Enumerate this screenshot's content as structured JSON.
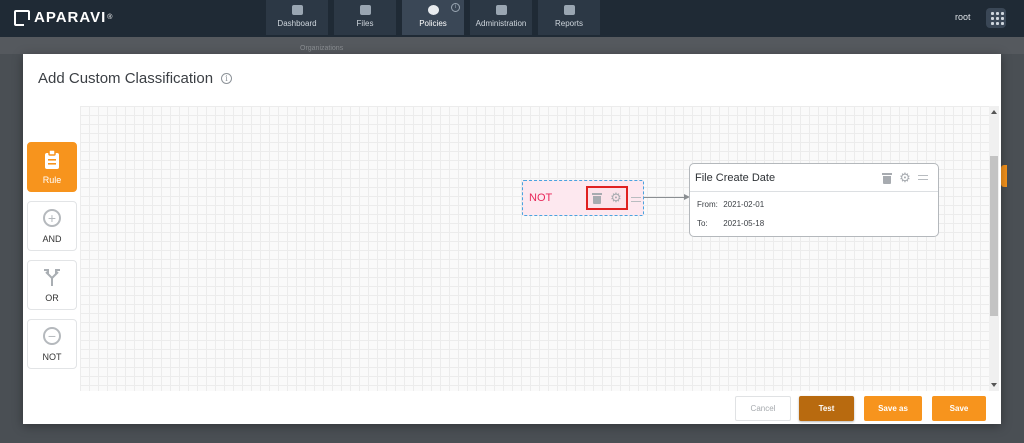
{
  "app": {
    "brand": "APARAVI",
    "trademark": "®"
  },
  "nav": {
    "tabs": [
      {
        "label": "Dashboard",
        "icon": "dashboard-icon"
      },
      {
        "label": "Files",
        "icon": "folder-icon"
      },
      {
        "label": "Policies",
        "icon": "gear-icon",
        "active": true,
        "badge": "i"
      },
      {
        "label": "Administration",
        "icon": "users-icon"
      },
      {
        "label": "Reports",
        "icon": "clipboard-icon"
      }
    ],
    "user": "root"
  },
  "background": {
    "breadcrumb": "Organizations"
  },
  "modal": {
    "title": "Add Custom Classification",
    "palette": [
      {
        "label": "Rule",
        "icon": "clipboard-icon",
        "active": true
      },
      {
        "label": "AND",
        "icon": "plus-circle-icon"
      },
      {
        "label": "OR",
        "icon": "branch-icon"
      },
      {
        "label": "NOT",
        "icon": "minus-circle-icon"
      }
    ],
    "not_node": {
      "label": "NOT"
    },
    "date_node": {
      "title": "File Create Date",
      "from_label": "From:",
      "from_value": "2021-02-01",
      "to_label": "To:",
      "to_value": "2021-05-18"
    },
    "buttons": {
      "cancel": "Cancel",
      "test": "Test",
      "save_as": "Save as",
      "save": "Save"
    }
  },
  "colors": {
    "accent": "#f7941d",
    "test_button": "#b86a0f",
    "not_text": "#e8285a",
    "selection_outline": "#e02020",
    "navbar": "#1f2a35"
  }
}
